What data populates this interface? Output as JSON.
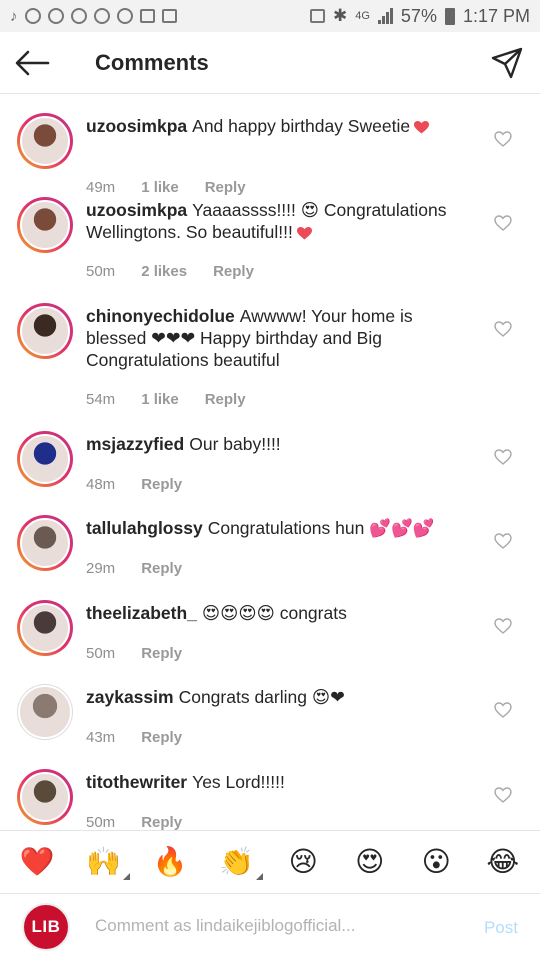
{
  "status_bar": {
    "battery_pct": "57%",
    "time": "1:17 PM"
  },
  "header": {
    "title": "Comments"
  },
  "comments": [
    {
      "username": "uzoosimkpa",
      "text": "And happy birthday Sweetie",
      "emojis": [
        "heart"
      ],
      "time": "49m",
      "likes": "1 like",
      "reply": "Reply",
      "avatar_color": "#7a4a3a"
    },
    {
      "username": "uzoosimkpa",
      "text": "Yaaaassss!!!! 😍 Congratulations Wellingtons.  So beautiful!!!",
      "emojis": [
        "heart"
      ],
      "time": "50m",
      "likes": "2 likes",
      "reply": "Reply",
      "avatar_color": "#7a4a3a"
    },
    {
      "username": "chinonyechidolue",
      "text": "Awwww! Your home is blessed ❤❤❤ Happy birthday and Big Congratulations beautiful",
      "emojis": [],
      "time": "54m",
      "likes": "1 like",
      "reply": "Reply",
      "avatar_color": "#3a2a22"
    },
    {
      "username": "msjazzyfied",
      "text": "Our baby!!!!",
      "emojis": [],
      "time": "48m",
      "likes": "",
      "reply": "Reply",
      "avatar_color": "#1e2e8a"
    },
    {
      "username": "tallulahglossy",
      "text": "Congratulations hun 💕💕💕",
      "emojis": [],
      "time": "29m",
      "likes": "",
      "reply": "Reply",
      "avatar_color": "#6b5a52"
    },
    {
      "username": "theelizabeth_",
      "text": "😍😍😍😍 congrats",
      "emojis": [],
      "time": "50m",
      "likes": "",
      "reply": "Reply",
      "avatar_color": "#4a3a3a"
    },
    {
      "username": "zaykassim",
      "text": "Congrats darling 😍❤",
      "emojis": [],
      "time": "43m",
      "likes": "",
      "reply": "Reply",
      "avatar_color": "#8a7a72"
    },
    {
      "username": "titothewriter",
      "text": "Yes Lord!!!!!",
      "emojis": [],
      "time": "50m",
      "likes": "",
      "reply": "Reply",
      "avatar_color": "#5a4a3a"
    }
  ],
  "emoji_bar": [
    "❤️",
    "🙌",
    "🔥",
    "👏",
    "😢",
    "😍",
    "😮",
    "😂"
  ],
  "composer": {
    "avatar_text": "LIB",
    "placeholder": "Comment as lindaikejiblogofficial...",
    "post_label": "Post"
  },
  "colors": {
    "accent_post": "#b2dffc",
    "heart": "#ed4956",
    "meta_gray": "#8e8e8e"
  }
}
